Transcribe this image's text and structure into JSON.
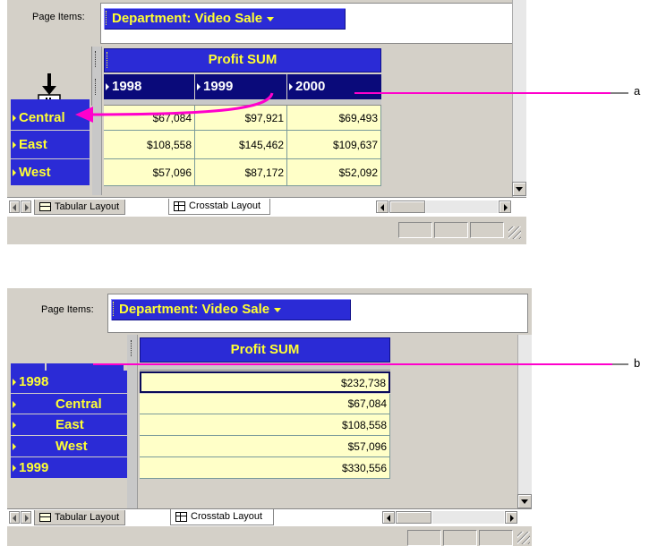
{
  "panel_a": {
    "page_items_label": "Page Items:",
    "page_item_value": "Department: Video Sale",
    "column_header": "Profit SUM",
    "years": [
      "1998",
      "1999",
      "2000"
    ],
    "rows": [
      {
        "label": "Central",
        "values": [
          "$67,084",
          "$97,921",
          "$69,493"
        ]
      },
      {
        "label": "East",
        "values": [
          "$108,558",
          "$145,462",
          "$109,637"
        ]
      },
      {
        "label": "West",
        "values": [
          "$57,096",
          "$87,172",
          "$52,092"
        ]
      }
    ],
    "tabs": [
      "Tabular Layout",
      "Crosstab Layout"
    ],
    "callout": "a"
  },
  "panel_b": {
    "page_items_label": "Page Items:",
    "page_item_value": "Department: Video Sale",
    "column_header": "Profit SUM",
    "rows": [
      {
        "label": "1998",
        "value": "$232,738",
        "level": 0
      },
      {
        "label": "Central",
        "value": "$67,084",
        "level": 1
      },
      {
        "label": "East",
        "value": "$108,558",
        "level": 1
      },
      {
        "label": "West",
        "value": "$57,096",
        "level": 1
      },
      {
        "label": "1999",
        "value": "$330,556",
        "level": 0
      }
    ],
    "tabs": [
      "Tabular Layout",
      "Crosstab Layout"
    ],
    "callout": "b"
  },
  "colors": {
    "header_blue": "#2b2bd6",
    "header_text": "#ffff33",
    "year_header_navy": "#0a0a7a",
    "cell_yellow": "#ffffc8",
    "arrow_magenta": "#ff00cc",
    "chrome_grey": "#d4d0c8"
  }
}
